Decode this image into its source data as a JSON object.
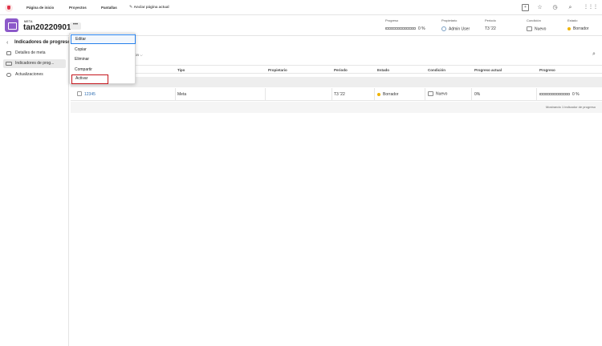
{
  "topnav": {
    "items": [
      "Página de inicio",
      "Proyectos",
      "Pantallas"
    ],
    "pin_label": "Anclar página actual",
    "icons": [
      "brand-logo-icon",
      "pin-icon",
      "new-item-icon",
      "star-icon",
      "recent-icon",
      "search-icon",
      "apps-grid-icon"
    ]
  },
  "header": {
    "kicker": "META",
    "title": "tan20220901",
    "more_label": "•••",
    "meta": {
      "progress_label": "Progreso",
      "progress_value": "0 %",
      "owner_label": "Propietario",
      "owner_value": "Admin User",
      "period_label": "Periodo",
      "period_value": "T3 '22",
      "condition_label": "Condición",
      "condition_value": "Nuevo",
      "status_label": "Estado",
      "status_value": "Borrador"
    }
  },
  "leftnav": {
    "back_glyph": "‹",
    "title": "Indicadores de progreso",
    "items": [
      {
        "label": "Detalles de meta",
        "selected": false
      },
      {
        "label": "Indicadores de prog...",
        "selected": true
      },
      {
        "label": "Actualizaciones",
        "selected": false
      }
    ]
  },
  "menu": {
    "items": [
      "Editar",
      "Copiar",
      "Eliminar",
      "Compartir",
      "Activar"
    ],
    "focused": "Editar",
    "highlighted": "Activar"
  },
  "toolbar": {
    "sort_suffix": "on ⌵"
  },
  "table": {
    "columns": [
      "Tipo",
      "Propietario",
      "Periodo",
      "Estado",
      "Condición",
      "Progreso actual",
      "Progreso"
    ],
    "rows": [
      {
        "name": "12345",
        "type": "Meta",
        "owner": "",
        "period": "T3 '22",
        "status": "Borrador",
        "condition": "Nuevo",
        "current_progress": "0%",
        "progress": "0 %"
      }
    ],
    "footer": "Mostrando 1 indicador de progreso"
  },
  "colors": {
    "brand": "#e0334a",
    "goal_icon": "#8c59c9",
    "status_draft": "#f0b400",
    "link": "#2f6fb3",
    "focus_outline": "#2680eb",
    "highlight_outline": "#c4161c"
  }
}
